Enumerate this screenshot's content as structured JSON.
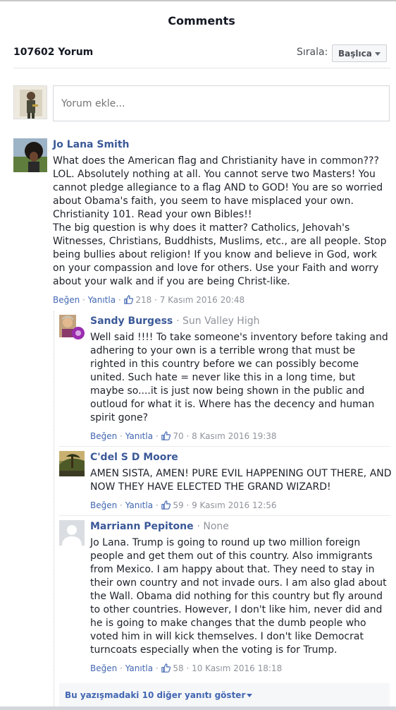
{
  "header": {
    "title": "Comments"
  },
  "toolbar": {
    "count": "107602 Yorum",
    "sort_label": "Sırala:",
    "sort_value": "Başlıca"
  },
  "composer": {
    "placeholder": "Yorum ekle..."
  },
  "comments": [
    {
      "author": "Jo Lana Smith",
      "affiliation": "",
      "text": "What does the American flag and Christianity have in common??? LOL. Absolutely nothing at all. You cannot serve two Masters! You cannot pledge allegiance to a flag AND to GOD! You are so worried about Obama's faith, you seem to have misplaced your own. Christianity 101. Read your own Bibles!!\nThe big question is why does it matter? Catholics, Jehovah's Witnesses, Christians, Buddhists, Muslims, etc., are all people. Stop being bullies about religion! If you know and believe in God, work on your compassion and love for others. Use your Faith and worry about your walk and if you are being Christ-like.",
      "like": "Beğen",
      "reply": "Yanıtla",
      "likes": "218",
      "date": "7 Kasım 2016 20:48"
    },
    {
      "author": "Sandy Burgess",
      "affiliation": "Sun Valley High",
      "text": "Well said !!!! To take someone's inventory before taking and adhering to your own is a terrible wrong that must be righted in this country before we can possibly become united. Such hate = never like this in a long time, but maybe so....it is just now being shown in the public and outloud for what it is. Where has the decency and human spirit gone?",
      "like": "Beğen",
      "reply": "Yanıtla",
      "likes": "70",
      "date": "8 Kasım 2016 19:38"
    },
    {
      "author": "C'del S D Moore",
      "affiliation": "",
      "text": "AMEN SISTA, AMEN! PURE EVIL HAPPENING OUT THERE, AND NOW THEY HAVE ELECTED THE GRAND WIZARD!",
      "like": "Beğen",
      "reply": "Yanıtla",
      "likes": "59",
      "date": "9 Kasım 2016 12:56"
    },
    {
      "author": "Marriann Pepitone",
      "affiliation": "None",
      "text": "Jo Lana. Trump is going to round up two million foreign people and get them out of this country. Also immigrants from Mexico. I am happy about that. They need to stay in their own country and not invade ours. I am also glad about the Wall. Obama did nothing for this country but fly around to other countries. However, I don't like him, never did and he is going to make changes that the dumb people who voted him in will kick themselves. I don't like Democrat turncoats especially when the voting is for Trump.",
      "like": "Beğen",
      "reply": "Yanıtla",
      "likes": "58",
      "date": "10 Kasım 2016 18:18"
    }
  ],
  "more_replies": "Bu yazışmadaki 10 diğer yanıtı göster",
  "icons": {
    "thumb": "thumbs-up-icon",
    "caret": "caret-down-icon",
    "more": "triangle-down-icon"
  },
  "colors": {
    "link": "#3b5998",
    "action": "#4267b2",
    "meta": "#90949c"
  }
}
